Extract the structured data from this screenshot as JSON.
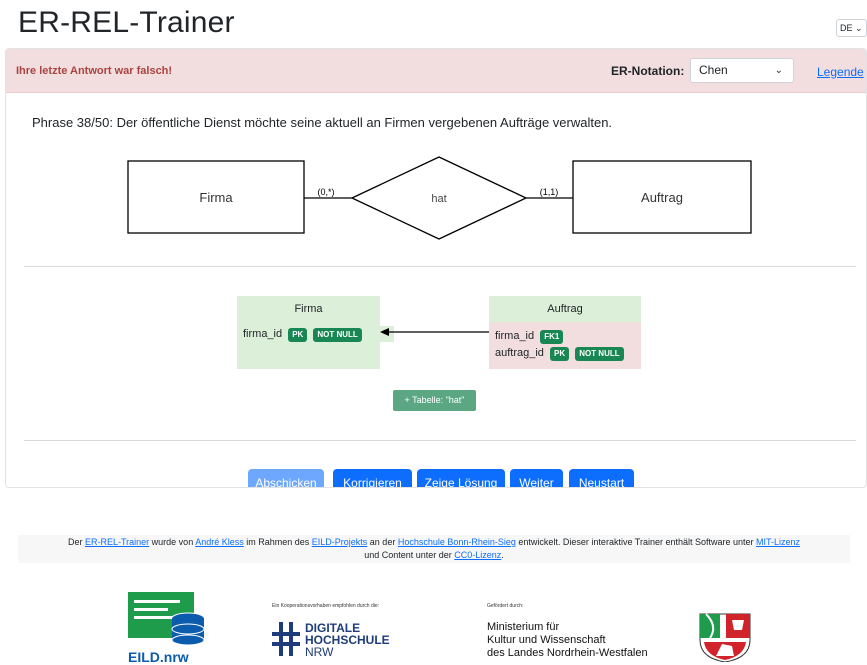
{
  "app": {
    "title": "ER-REL-Trainer",
    "language": "DE"
  },
  "alert": {
    "message": "Ihre letzte Antwort war falsch!"
  },
  "notation": {
    "label": "ER-Notation:",
    "selected": "Chen",
    "legend_link": "Legende"
  },
  "phrase": {
    "prefix": "Phrase 38/50:",
    "text": " Der öffentliche Dienst möchte seine aktuell an Firmen vergebenen Aufträge verwalten."
  },
  "er_diagram": {
    "entity_left": "Firma",
    "relationship": "hat",
    "entity_right": "Auftrag",
    "card_left": "(0,*)",
    "card_right": "(1,1)"
  },
  "relational": {
    "table_firma": {
      "name": "Firma",
      "rows": [
        {
          "attr": "firma_id",
          "badges": [
            "PK",
            "NOT NULL"
          ]
        }
      ]
    },
    "table_auftrag": {
      "name": "Auftrag",
      "rows": [
        {
          "attr": "firma_id",
          "badges": [
            "FK1"
          ]
        },
        {
          "attr": "auftrag_id",
          "badges": [
            "PK",
            "NOT NULL"
          ]
        }
      ]
    },
    "add_table_button": "+ Tabelle: \"hat\""
  },
  "buttons": {
    "submit": "Abschicken",
    "correct": "Korrigieren",
    "show_solution": "Zeige Lösung",
    "next": "Weiter",
    "restart": "Neustart"
  },
  "footer": {
    "t1": "Der ",
    "l1": "ER-REL-Trainer",
    "t2": " wurde von ",
    "l2": "André Kless",
    "t3": " im Rahmen des ",
    "l3": "EILD-Projekts",
    "t4": " an der ",
    "l4": "Hochschule Bonn-Rhein-Sieg",
    "t5": " entwickelt. Dieser interaktive Trainer enthält Software unter ",
    "l5": "MIT-Lizenz",
    "t6": " und Content unter der ",
    "l6": "CC0-Lizenz",
    "t7": "."
  },
  "logos": {
    "eild": "EILD.nrw",
    "dh_caption": "Ein Kooperationsvorhaben empfohlen durch die:",
    "dh_line1": "DIGITALE",
    "dh_line2": "HOCHSCHULE",
    "dh_line3": "NRW",
    "min_caption": "Gefördert durch:",
    "min_line1": "Ministerium für",
    "min_line2": "Kultur und Wissenschaft",
    "min_line3": "des Landes Nordrhein-Westfalen"
  },
  "colors": {
    "alert_bg": "#f2dede",
    "alert_text": "#a94442",
    "primary": "#0d6efd",
    "badge_green": "#198754",
    "table_green": "#dcefd8",
    "fk_red": "#f2dede"
  }
}
